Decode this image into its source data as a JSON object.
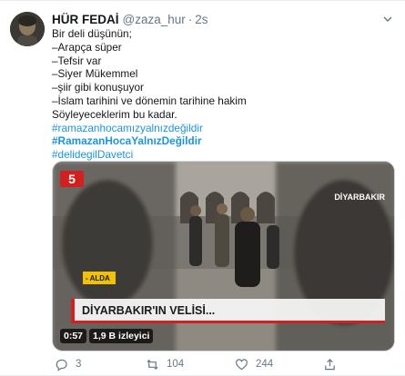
{
  "tweet": {
    "author_name": "HÜR FEDAİ",
    "handle": "@zaza_hur",
    "separator": "·",
    "time": "2s",
    "lines": [
      "Bir deli düşünün;",
      "–Arapça süper",
      "–Tefsir var",
      "–Siyer Mükemmel",
      "–şiir gibi konuşuyor",
      "–İslam tarihini ve dönemin tarihine hakim",
      "Söyleyeceklerim bu kadar."
    ],
    "hashtags": [
      "#ramazanhocamızyalnızdeğildir",
      "#RamazanHocaYalnızDeğildir",
      "#delidegilDavetci"
    ],
    "media": {
      "channel_logo": "5",
      "location_tag": "DİYARBAKIR",
      "side_tag": "- ALDA",
      "lower_third": "DİYARBAKIR'IN VELİSİ...",
      "duration": "0:57",
      "views": "1,9 B izleyici"
    },
    "actions": {
      "replies": "3",
      "retweets": "104",
      "likes": "244"
    },
    "colors": {
      "link": "#1b95e0",
      "muted": "#657786",
      "text": "#14171a"
    }
  }
}
